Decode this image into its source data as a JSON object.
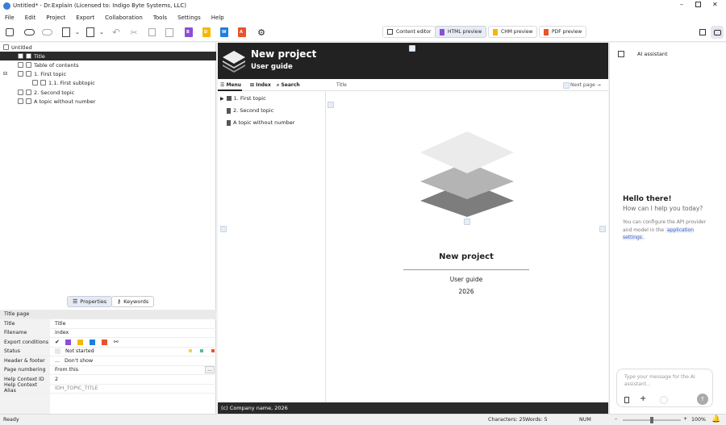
{
  "window": {
    "title": "Untitled* - Dr.Explain (Licensed to: Indigo Byte Systems, LLC)"
  },
  "menu": [
    "File",
    "Edit",
    "Project",
    "Export",
    "Collaboration",
    "Tools",
    "Settings",
    "Help"
  ],
  "toolbar": {
    "content_editor": "Content editor",
    "html_preview": "HTML preview",
    "chm_preview": "CHM preview",
    "pdf_preview": "PDF preview",
    "icons": {
      "b1": "B",
      "b2": "D",
      "b3": "W",
      "b4": "A"
    }
  },
  "tree": {
    "root": "Untitled",
    "items": [
      "Title",
      "Table of contents",
      "1. First topic",
      "1.1. First subtopic",
      "2. Second topic",
      "A topic without number"
    ]
  },
  "panel_tabs": {
    "properties": "Properties",
    "keywords": "Keywords"
  },
  "props": {
    "section": "Title page",
    "rows": [
      {
        "k": "Title",
        "v": "Title"
      },
      {
        "k": "Filename",
        "v": "index"
      },
      {
        "k": "Export conditions",
        "v": ""
      },
      {
        "k": "Status",
        "v": "Not started"
      },
      {
        "k": "Header & footer",
        "v": "Don't show"
      },
      {
        "k": "Page numbering",
        "v": "From this"
      },
      {
        "k": "Help Context ID",
        "v": "2"
      },
      {
        "k": "Help Context Alias",
        "v": "IDH_TOPIC_TITLE"
      }
    ],
    "header_prefix": "...",
    "numbering_more": "..."
  },
  "preview": {
    "project": "New project",
    "subtitle": "User guide",
    "nav": {
      "menu": "Menu",
      "index": "Index",
      "search": "Search"
    },
    "breadcrumb": "Title",
    "next": "Next page →",
    "toc": [
      "1. First topic",
      "2. Second topic",
      "A topic without number"
    ],
    "page_title": "New project",
    "page_subtitle": "User guide",
    "year": "2026",
    "footer": "(c) Company name, 2026"
  },
  "ai": {
    "title": "AI assistant",
    "hello": "Hello there!",
    "ask": "How can I help you today?",
    "note": "You can configure the API provider and model in the",
    "link": "application settings",
    "link_end": ".",
    "placeholder": "Type your message for the AI assistant..."
  },
  "status": {
    "ready": "Ready",
    "chars": "Characters: 25",
    "words": "Words: 5",
    "num": "NUM",
    "zoom": "100%"
  },
  "colors": {
    "accent": "#5b6fd6",
    "tb_purple": "#8a4fd8",
    "tb_yellow": "#f5b800",
    "tb_blue": "#1e7fe0",
    "tb_red": "#e8532a"
  }
}
